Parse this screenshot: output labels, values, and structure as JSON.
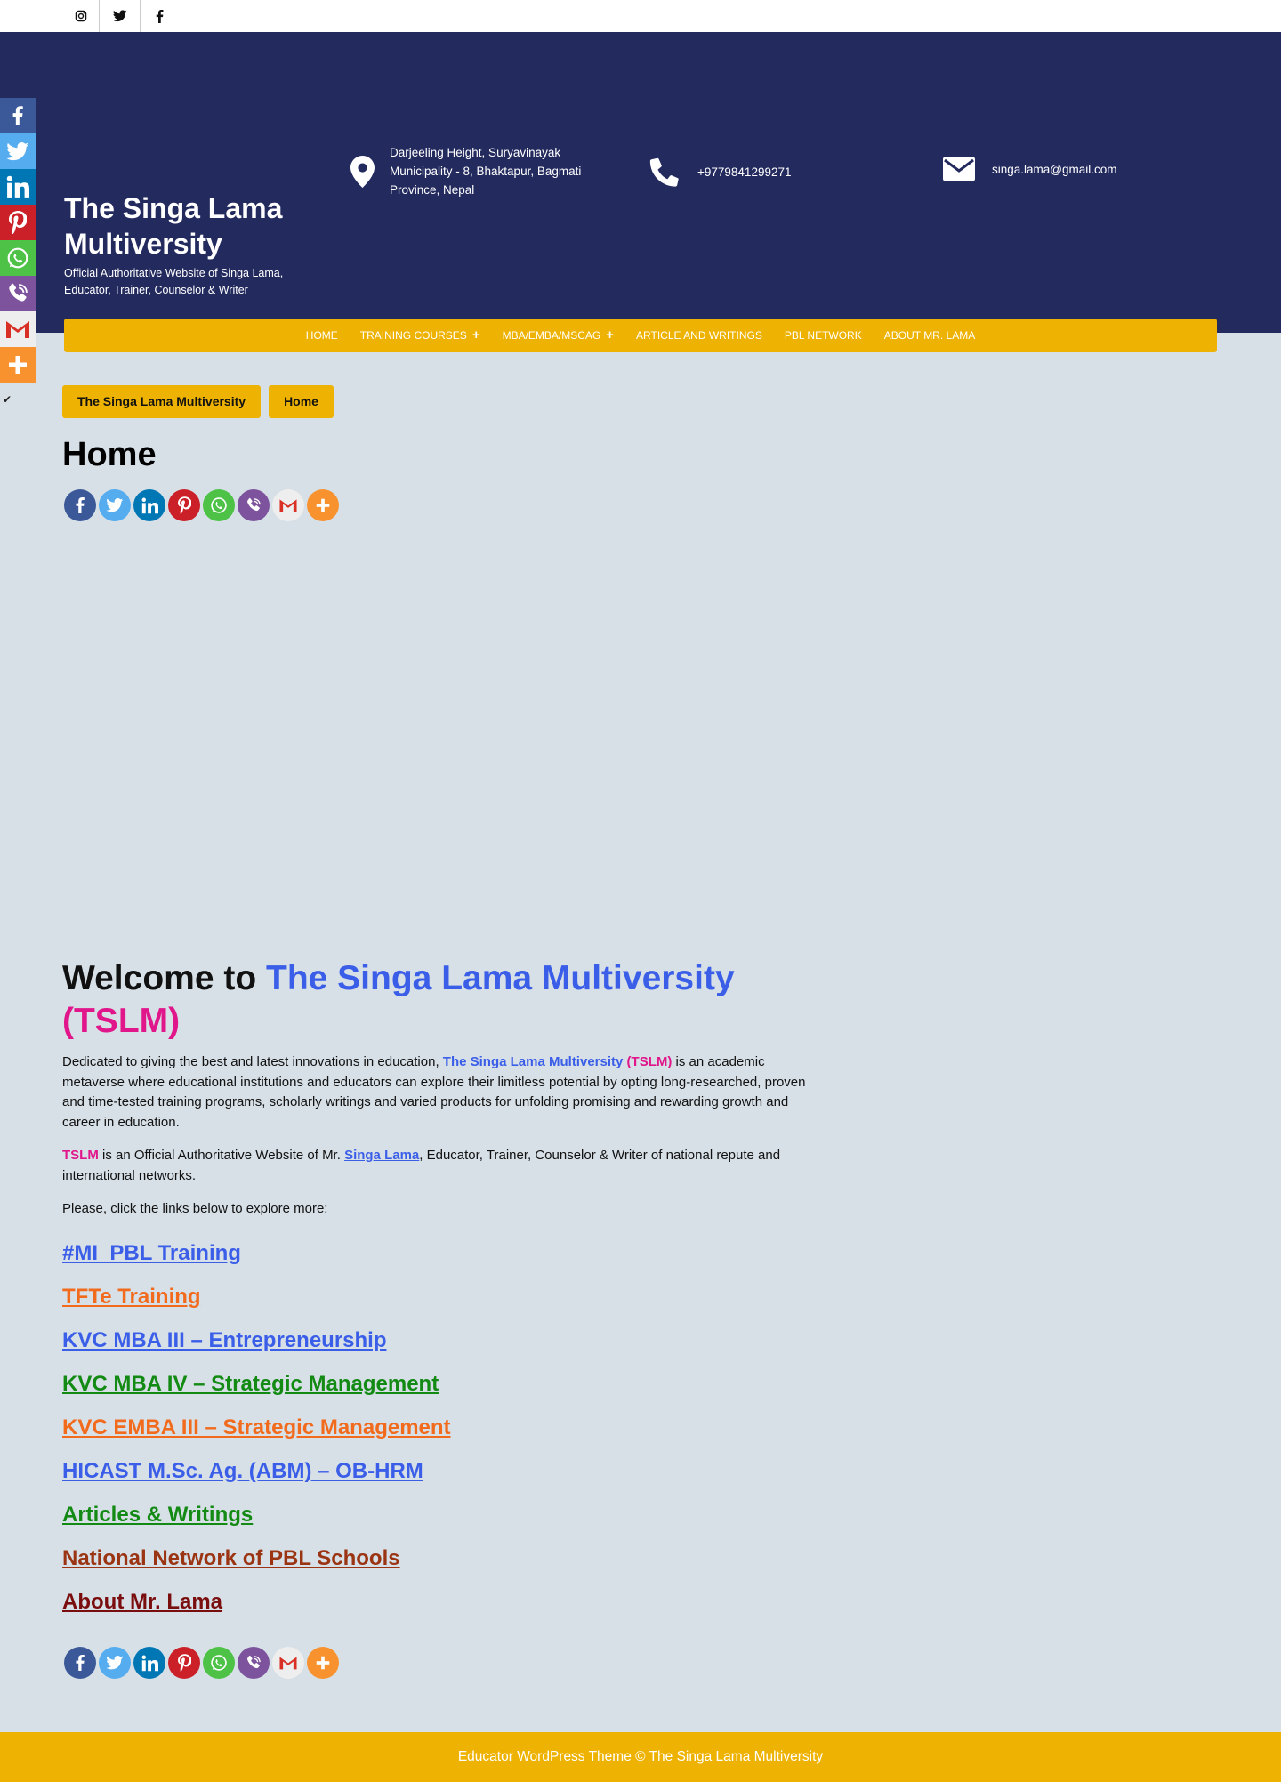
{
  "topbar": {
    "social_icons": [
      "instagram-icon",
      "twitter-icon",
      "facebook-icon"
    ]
  },
  "header": {
    "site_title": "The Singa Lama Multiversity",
    "tagline": "Official Authoritative Website of Singa Lama, Educator, Trainer, Counselor & Writer",
    "address": "Darjeeling Height, Suryavinayak Municipality - 8, Bhaktapur, Bagmati Province, Nepal",
    "phone": "+9779841299271",
    "email": "singa.lama@gmail.com"
  },
  "nav": {
    "items": [
      {
        "label": "HOME",
        "has_submenu": false
      },
      {
        "label": "TRAINING COURSES",
        "has_submenu": true
      },
      {
        "label": "MBA/EMBA/MSCAG",
        "has_submenu": true
      },
      {
        "label": "ARTICLE AND WRITINGS",
        "has_submenu": false
      },
      {
        "label": "PBL NETWORK",
        "has_submenu": false
      },
      {
        "label": "ABOUT MR. LAMA",
        "has_submenu": false
      }
    ]
  },
  "share": {
    "networks": [
      {
        "name": "facebook-icon",
        "color": "#3b5998"
      },
      {
        "name": "twitter-icon",
        "color": "#55acee"
      },
      {
        "name": "linkedin-icon",
        "color": "#0077b5"
      },
      {
        "name": "pinterest-icon",
        "color": "#cb2027"
      },
      {
        "name": "whatsapp-icon",
        "color": "#4dc247"
      },
      {
        "name": "viber-icon",
        "color": "#7d539d"
      },
      {
        "name": "gmail-icon",
        "color": "#dddddd"
      },
      {
        "name": "more-icon",
        "color": "#f7922f"
      }
    ]
  },
  "breadcrumb": {
    "items": [
      "The Singa Lama Multiversity",
      "Home"
    ]
  },
  "page": {
    "title": "Home"
  },
  "content": {
    "welcome_prefix": "Welcome to ",
    "welcome_name": "The Singa Lama Multiversity",
    "welcome_abbr": "(TSLM)",
    "p1_start": "Dedicated to giving the best and latest innovations in education, ",
    "p1_name": "The Singa Lama Multiversity",
    "p1_abbr": "(TSLM)",
    "p1_rest": " is an academic metaverse where educational institutions and educators can explore their limitless potential by opting long-researched, proven and time-tested training programs, scholarly writings and varied products for unfolding promising and rewarding growth and career in education.",
    "p2_abbr": "TSLM",
    "p2_mid": " is an Official Authoritative Website of Mr. ",
    "p2_link": "Singa Lama",
    "p2_rest": ", Educator, Trainer, Counselor & Writer of national repute and international networks.",
    "p3": "Please, click the links below to explore more:",
    "links": [
      {
        "label": "#MI_PBL Training",
        "color": "#3b5ee8"
      },
      {
        "label": "TFTe Training",
        "color": "#f26b1d"
      },
      {
        "label": "KVC MBA III – Entrepreneurship",
        "color": "#3b5ee8"
      },
      {
        "label": "KVC MBA IV – Strategic Management",
        "color": "#138a13"
      },
      {
        "label": "KVC EMBA III – Strategic Management",
        "color": "#f26b1d"
      },
      {
        "label": "HICAST M.Sc. Ag. (ABM) – OB-HRM",
        "color": "#3b5ee8"
      },
      {
        "label": "Articles & Writings",
        "color": "#138a13"
      },
      {
        "label": "National Network of PBL Schools",
        "color": "#9a3412"
      },
      {
        "label": "About Mr. Lama",
        "color": "#7a0d0d"
      }
    ]
  },
  "footer": {
    "text": "Educator WordPress Theme © The Singa Lama Multiversity"
  },
  "colors": {
    "header_bg": "#232a5e",
    "accent_yellow": "#eeb202",
    "page_bg": "#d7e0e7",
    "link_blue": "#3b5ee8",
    "highlight_pink": "#e0168a"
  }
}
